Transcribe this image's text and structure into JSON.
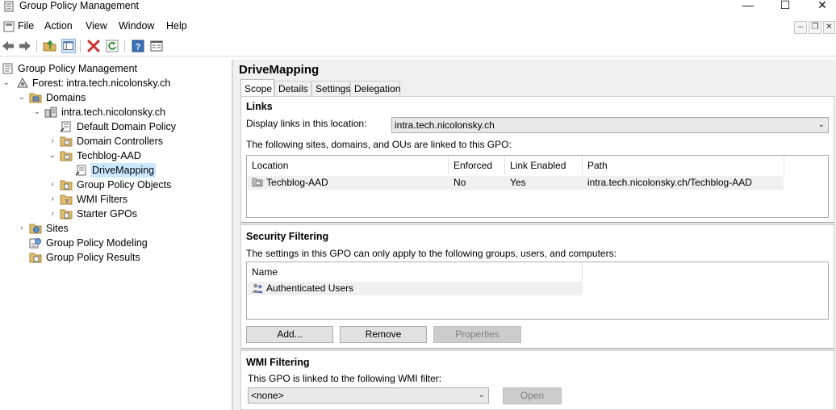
{
  "window": {
    "title": "Group Policy Management",
    "controls": {
      "minimize": "—",
      "maximize": "☐",
      "close": "✕"
    }
  },
  "menu": {
    "items": [
      "File",
      "Action",
      "View",
      "Window",
      "Help"
    ],
    "mdi_controls": [
      "–",
      "❐",
      "✕"
    ]
  },
  "toolbar": {
    "buttons": [
      "back-arrow-icon",
      "forward-arrow-icon",
      "up-folder-icon",
      "show-hide-tree-icon",
      "delete-icon",
      "refresh-icon",
      "help-icon",
      "properties-icon"
    ]
  },
  "tree": {
    "nodes": [
      {
        "label": "Group Policy Management",
        "icon": "gpm-root-icon",
        "expander": ""
      },
      {
        "label": "Forest: intra.tech.nicolonsky.ch",
        "icon": "forest-icon",
        "expander": "⌄"
      },
      {
        "label": "Domains",
        "icon": "domains-folder-icon",
        "expander": "⌄"
      },
      {
        "label": "intra.tech.nicolonsky.ch",
        "icon": "domain-icon",
        "expander": "⌄"
      },
      {
        "label": "Default Domain Policy",
        "icon": "gpo-link-icon",
        "expander": ""
      },
      {
        "label": "Domain Controllers",
        "icon": "ou-icon",
        "expander": "›"
      },
      {
        "label": "Techblog-AAD",
        "icon": "ou-icon",
        "expander": "⌄"
      },
      {
        "label": "DriveMapping",
        "icon": "gpo-link-icon",
        "expander": ""
      },
      {
        "label": "Group Policy Objects",
        "icon": "gpo-folder-icon",
        "expander": "›"
      },
      {
        "label": "WMI Filters",
        "icon": "wmi-folder-icon",
        "expander": "›"
      },
      {
        "label": "Starter GPOs",
        "icon": "starter-folder-icon",
        "expander": "›"
      },
      {
        "label": "Sites",
        "icon": "sites-icon",
        "expander": "›"
      },
      {
        "label": "Group Policy Modeling",
        "icon": "modeling-icon",
        "expander": ""
      },
      {
        "label": "Group Policy Results",
        "icon": "results-icon",
        "expander": ""
      }
    ]
  },
  "details": {
    "title": "DriveMapping",
    "tabs": [
      "Scope",
      "Details",
      "Settings",
      "Delegation"
    ],
    "links": {
      "heading": "Links",
      "location_label": "Display links in this location:",
      "location_value": "intra.tech.nicolonsky.ch",
      "description": "The following sites, domains, and OUs are linked to this GPO:",
      "columns": [
        "Location",
        "Enforced",
        "Link Enabled",
        "Path"
      ],
      "rows": [
        {
          "location": "Techblog-AAD",
          "enforced": "No",
          "link_enabled": "Yes",
          "path": "intra.tech.nicolonsky.ch/Techblog-AAD"
        }
      ]
    },
    "security": {
      "heading": "Security Filtering",
      "description": "The settings in this GPO can only apply to the following groups, users, and computers:",
      "column": "Name",
      "rows": [
        "Authenticated Users"
      ],
      "add_label": "Add...",
      "remove_label": "Remove",
      "properties_label": "Properties"
    },
    "wmi": {
      "heading": "WMI Filtering",
      "description": "This GPO is linked to the following WMI filter:",
      "filter_value": "<none>",
      "open_label": "Open"
    }
  }
}
